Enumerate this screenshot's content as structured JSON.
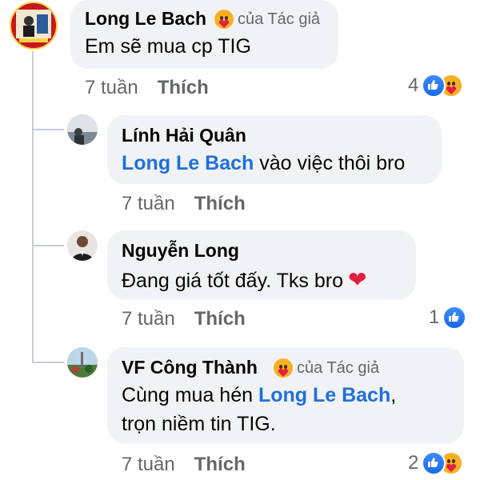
{
  "comments": [
    {
      "name": "Long Le Bach",
      "badge": "của Tác giả",
      "text": "Em sẽ mua cp TIG",
      "time": "7 tuần",
      "like_label": "Thích",
      "reaction_count": "4",
      "reactions": [
        "like-icon",
        "care-icon"
      ]
    },
    {
      "name": "Lính Hải Quân",
      "mention": "Long Le Bach",
      "text": " vào việc thôi bro",
      "time": "7 tuần",
      "like_label": "Thích"
    },
    {
      "name": "Nguyễn Long",
      "text": "Đang giá tốt đấy. Tks bro",
      "emoji": "❤",
      "time": "7 tuần",
      "like_label": "Thích",
      "reaction_count": "1",
      "reactions": [
        "like-icon"
      ]
    },
    {
      "name": "VF Công Thành",
      "badge": "của Tác giả",
      "text_line1": "Cùng mua hén ",
      "mention": "Long Le Bach",
      "text_line1_end": ",",
      "text_line2": "trọn niềm tin TIG.",
      "time": "7 tuần",
      "like_label": "Thích",
      "reaction_count": "2",
      "reactions": [
        "like-icon",
        "care-icon"
      ]
    }
  ],
  "colors": {
    "mention": "#216fdb",
    "bubble": "#f0f2f5",
    "meta": "#65676b",
    "like_blue": "#1877f2"
  }
}
